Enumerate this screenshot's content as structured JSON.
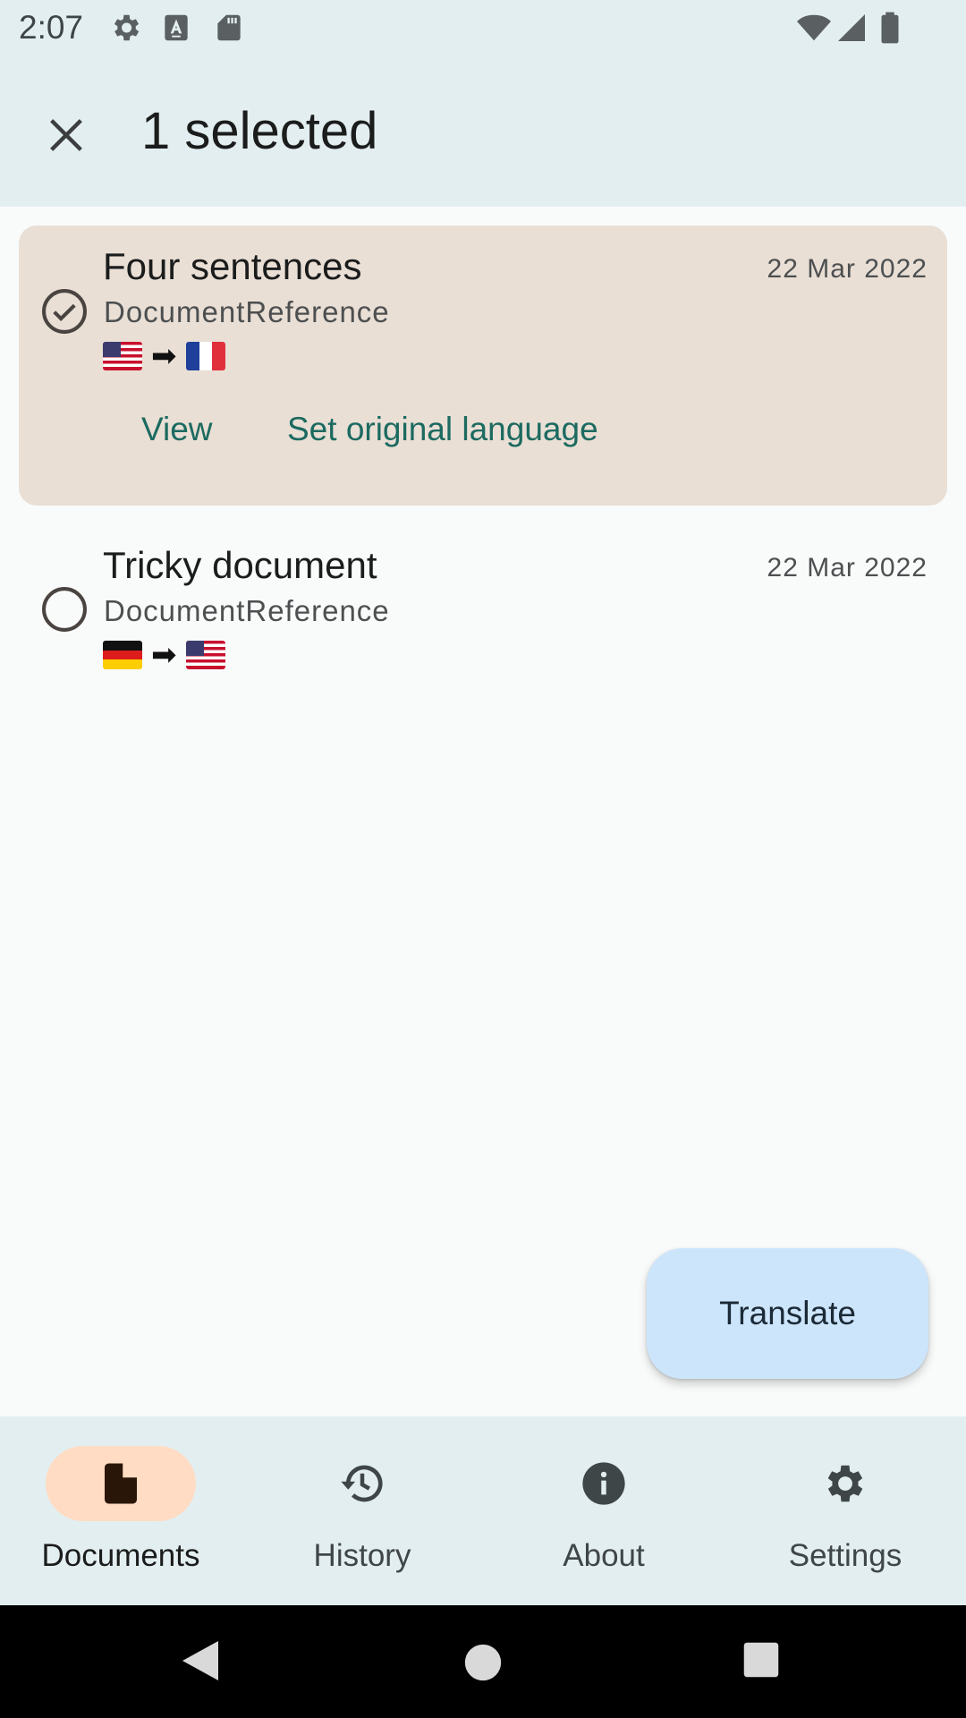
{
  "status_bar": {
    "time": "2:07",
    "icons_left": [
      "gear-icon",
      "text-a-icon",
      "sd-card-icon"
    ],
    "icons_right": [
      "wifi-icon",
      "cell-signal-icon",
      "battery-icon"
    ]
  },
  "top_bar": {
    "title": "1 selected",
    "close_icon": "close-icon"
  },
  "documents": [
    {
      "title": "Four sentences",
      "subtitle": "DocumentReference",
      "date": "22 Mar 2022",
      "selected": true,
      "from_flag": "us-flag",
      "to_flag": "fr-flag",
      "arrow": "➡",
      "actions": [
        "View",
        "Set original language"
      ]
    },
    {
      "title": "Tricky document",
      "subtitle": "DocumentReference",
      "date": "22 Mar 2022",
      "selected": false,
      "from_flag": "de-flag",
      "to_flag": "us-flag",
      "arrow": "➡"
    }
  ],
  "fab": {
    "label": "Translate"
  },
  "bottom_nav": {
    "items": [
      {
        "label": "Documents",
        "icon": "document-icon",
        "active": true
      },
      {
        "label": "History",
        "icon": "history-icon",
        "active": false
      },
      {
        "label": "About",
        "icon": "info-icon",
        "active": false
      },
      {
        "label": "Settings",
        "icon": "gear-icon",
        "active": false
      }
    ]
  },
  "colors": {
    "bar_background": "#e3eef1",
    "selected_card": "#e9dfd5",
    "action_text": "#1c6a60",
    "fab_background": "#cde5fb",
    "nav_active_pill": "#ffdcc3"
  }
}
